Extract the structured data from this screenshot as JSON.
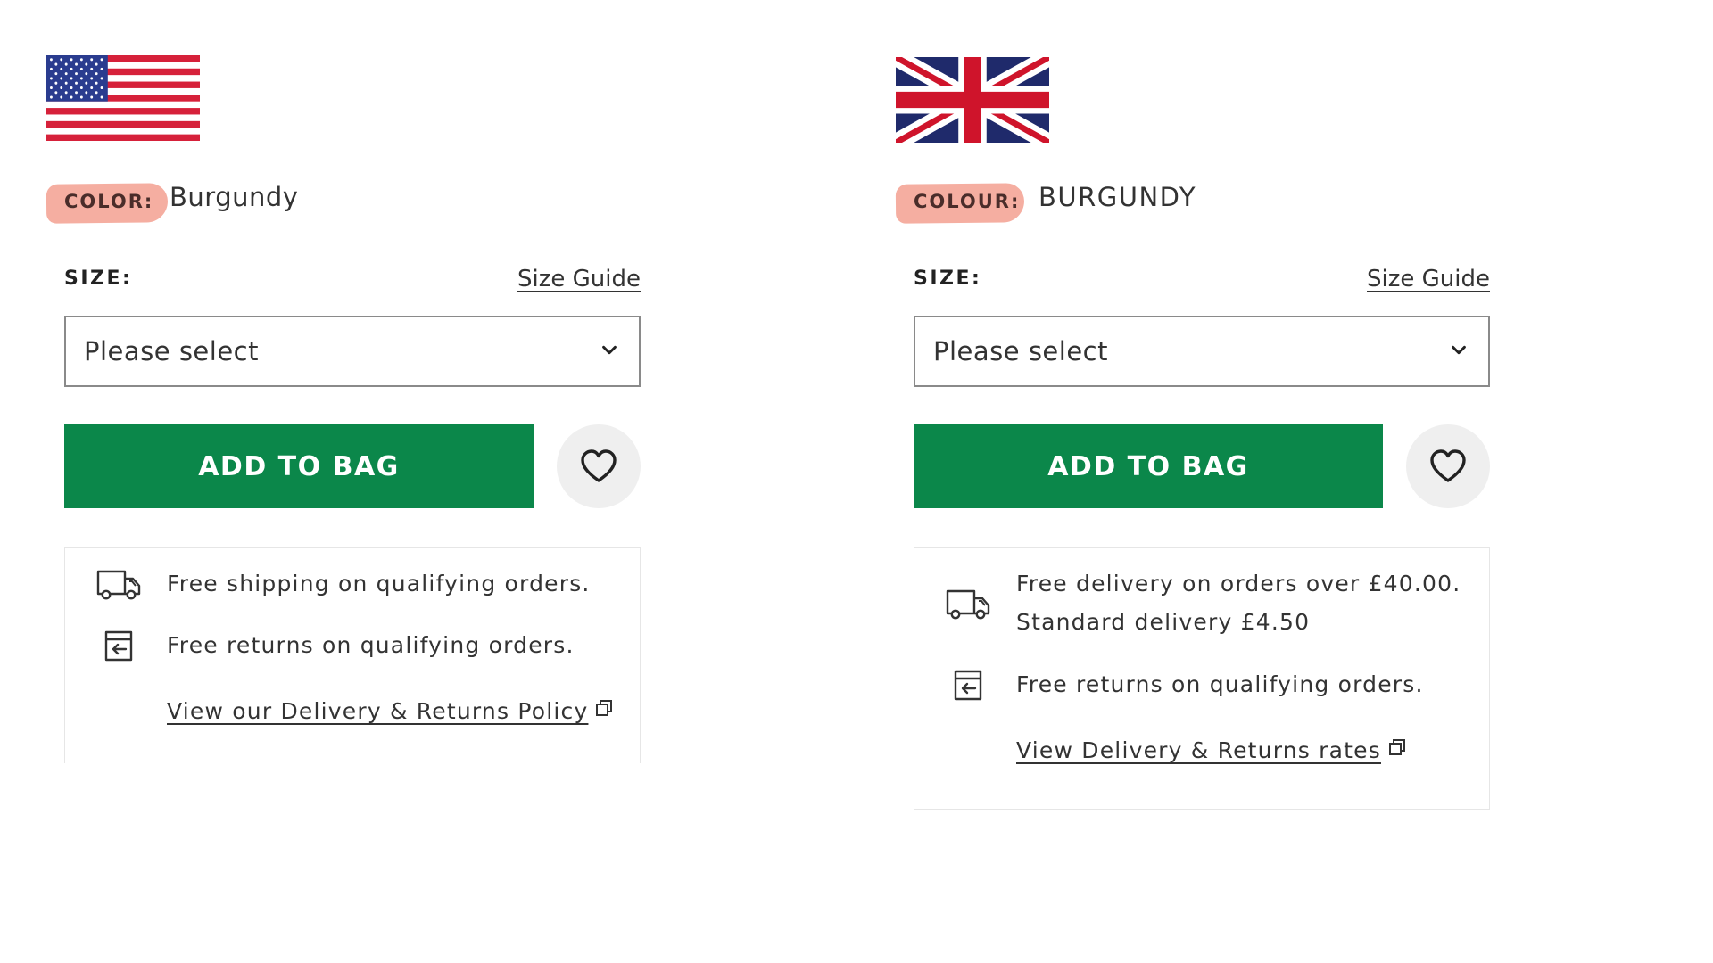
{
  "panels": {
    "us": {
      "flag": "us-flag",
      "color_label": "COLOR:",
      "color_value": "Burgundy",
      "size_label": "SIZE:",
      "size_guide": "Size Guide",
      "size_select": {
        "value": "Please select"
      },
      "add_to_bag": "ADD TO BAG",
      "shipping": "Free shipping on qualifying orders.",
      "returns": "Free returns on qualifying orders.",
      "policy_link": "View our Delivery & Returns Policy"
    },
    "uk": {
      "flag": "uk-flag",
      "color_label": "COLOUR:",
      "color_value": "BURGUNDY",
      "size_label": "SIZE:",
      "size_guide": "Size Guide",
      "size_select": {
        "value": "Please select"
      },
      "add_to_bag": "ADD TO BAG",
      "delivery_line1": "Free delivery on orders over £40.00.",
      "delivery_line2": "Standard delivery £4.50",
      "returns": "Free returns on qualifying orders.",
      "policy_link": "View Delivery & Returns rates"
    }
  },
  "colors": {
    "button_green": "#0b874a",
    "highlight": "#f4a597",
    "wishlist_bg": "#efefef"
  },
  "icons": [
    "us-flag",
    "uk-flag",
    "chevron-down-icon",
    "heart-icon",
    "truck-icon",
    "returns-box-icon",
    "external-link-icon"
  ]
}
